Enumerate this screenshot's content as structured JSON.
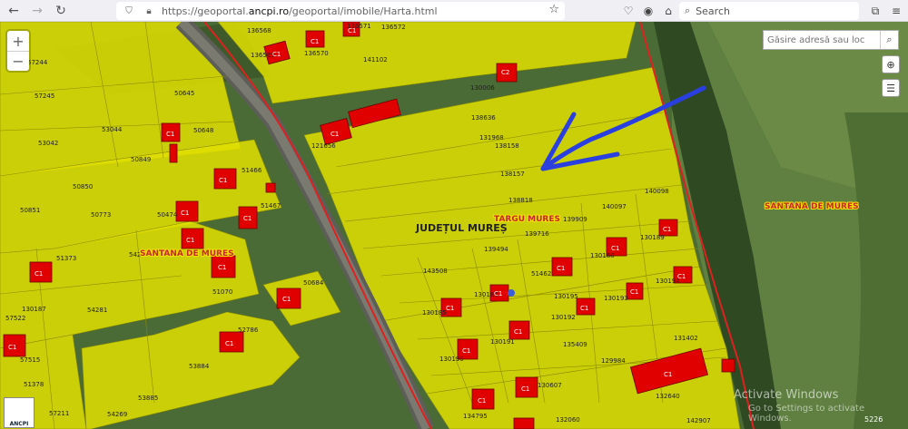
{
  "browser": {
    "url_prefix": "https://geoportal.",
    "url_domain": "ancpi.ro",
    "url_suffix": "/geoportal/imobile/Harta.html",
    "search_label": "Search"
  },
  "map": {
    "zoom_in": "+",
    "zoom_out": "−",
    "search_placeholder": "Găsire adresă sau loc",
    "county_label": "JUDEȚUL MUREȘ",
    "labels_red": [
      {
        "id": "targu",
        "text": "TARGU MURES"
      },
      {
        "id": "santana_left",
        "text": "SANTANA DE MURES"
      },
      {
        "id": "santana_right",
        "text": "SANTANA DE MURES"
      }
    ],
    "parcels": [
      "136568",
      "136571",
      "136572",
      "57244",
      "136569",
      "136570",
      "141102",
      "57245",
      "50645",
      "130006",
      "53044",
      "50648",
      "138636",
      "53042",
      "121656",
      "131968",
      "138158",
      "50849",
      "51466",
      "138157",
      "50850",
      "51467",
      "138818",
      "50851",
      "50773",
      "50474",
      "140097",
      "140098",
      "139909",
      "139716",
      "542",
      "51373",
      "139494",
      "130189",
      "143508",
      "130188",
      "51462",
      "130187",
      "130194",
      "51070",
      "50684",
      "130186",
      "130195",
      "130193",
      "54281",
      "130185",
      "130192",
      "57522",
      "52786",
      "135409",
      "131402",
      "130191",
      "57515",
      "130190",
      "129984",
      "53884",
      "51378",
      "130607",
      "132640",
      "53885",
      "54269",
      "57211",
      "134795",
      "132060",
      "142907"
    ],
    "buildings": [
      "C1",
      "C2"
    ],
    "scale_label": "5226",
    "logo_text": "ANCPI"
  },
  "os": {
    "activate_title": "Activate Windows",
    "activate_sub": "Go to Settings to activate Windows."
  }
}
